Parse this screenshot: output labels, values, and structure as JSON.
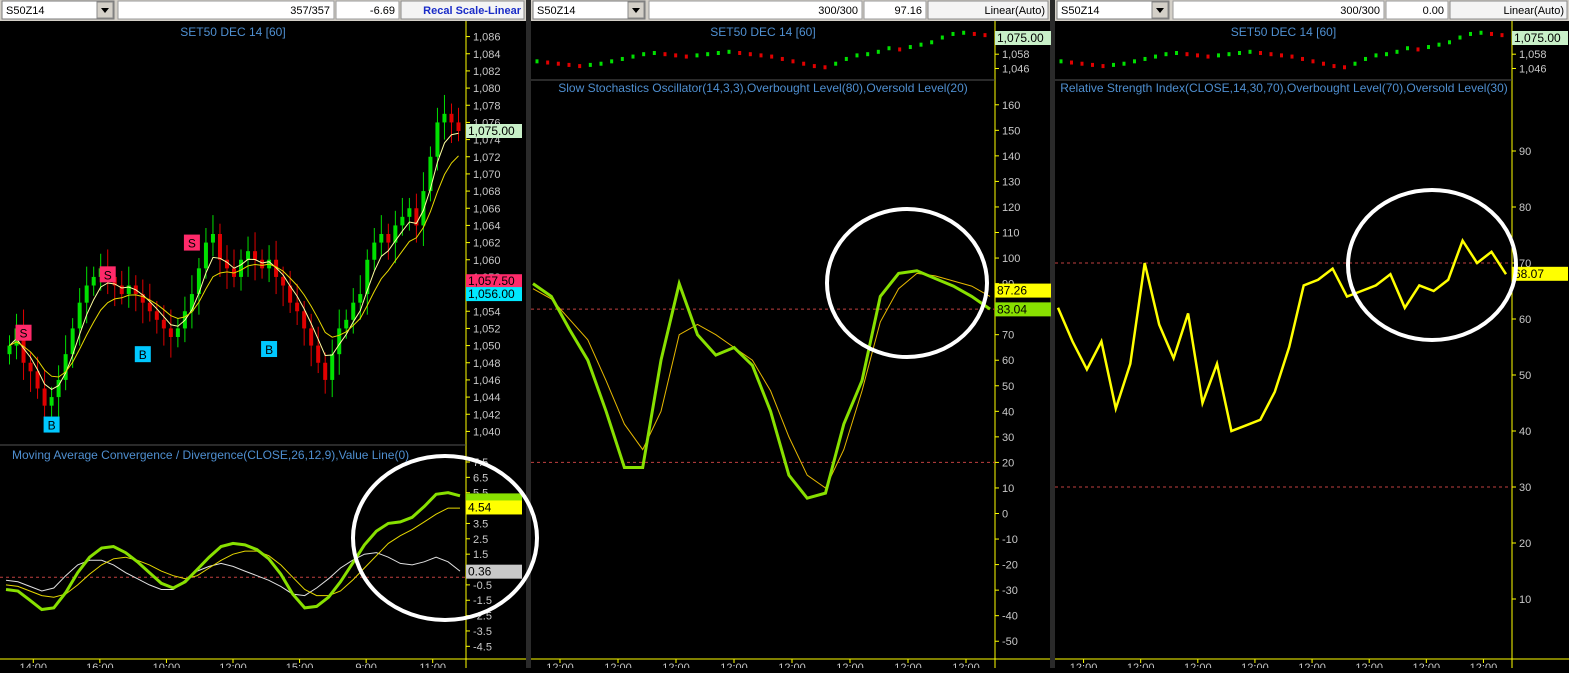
{
  "colors": {
    "background": "#000000",
    "axis": "#ffff00",
    "axis_label": "#c8c8c8",
    "title": "#4f8fd0",
    "up_candle": "#00e000",
    "down_candle": "#e00000",
    "macd_line": "#88e000",
    "signal_line": "#e6d800",
    "value_line": "#e0e0e0",
    "level_line": "#c04040",
    "rsi_line": "#ffff00",
    "buy_marker": "#00c8ff",
    "sell_marker": "#ff2a6a",
    "highlight_circle": "#ffffff"
  },
  "panels": [
    {
      "symbol": "S50Z14",
      "count": "357/357",
      "value": "-6.69",
      "scale_button": "Recal Scale-Linear",
      "price_title": "SET50 DEC 14  [60]"
    },
    {
      "symbol": "S50Z14",
      "count": "300/300",
      "value": "97.16",
      "scale_button": "Linear(Auto)",
      "price_title": "SET50 DEC 14  [60]",
      "indicator_title": "Slow Stochastics Oscillator(14,3,3),Overbought Level(80),Oversold Level(20)"
    },
    {
      "symbol": "S50Z14",
      "count": "300/300",
      "value": "0.00",
      "scale_button": "Linear(Auto)",
      "price_title": "SET50 DEC 14  [60]",
      "indicator_title": "Relative Strength Index(CLOSE,14,30,70),Overbought Level(70),Oversold Level(30)"
    }
  ],
  "chart_data": [
    {
      "type": "candlestick",
      "panel": "price-main",
      "title": "SET50 DEC 14  [60]",
      "ylim": [
        1039,
        1087
      ],
      "y_ticks": [
        "1,086",
        "1,084",
        "1,082",
        "1,080",
        "1,078",
        "1,076",
        "1,074",
        "1,072",
        "1,070",
        "1,068",
        "1,066",
        "1,064",
        "1,062",
        "1,060",
        "1,058",
        "1,056",
        "1,054",
        "1,052",
        "1,050",
        "1,048",
        "1,046",
        "1,044",
        "1,042",
        "1,040"
      ],
      "x_ticks": [
        "14:00",
        "16:00",
        "10:00",
        "12:00",
        "15:00",
        "9:00",
        "11:00"
      ],
      "closes": [
        1050,
        1052,
        1048,
        1047,
        1045,
        1043,
        1044,
        1046,
        1049,
        1052,
        1055,
        1057,
        1058,
        1059,
        1058,
        1057,
        1056,
        1057,
        1056,
        1055,
        1054,
        1053,
        1052,
        1051,
        1052,
        1054,
        1056,
        1059,
        1062,
        1063,
        1060,
        1059,
        1058,
        1060,
        1061,
        1060,
        1059,
        1060,
        1058,
        1057,
        1055,
        1054,
        1052,
        1050,
        1048,
        1046,
        1049,
        1052,
        1053,
        1055,
        1056,
        1060,
        1062,
        1063,
        1062,
        1064,
        1065,
        1066,
        1064,
        1068,
        1072,
        1076,
        1077,
        1076,
        1075
      ],
      "last_price": "1,075.00",
      "price_tags": [
        "1,057.50",
        "1,056.00"
      ],
      "signals": [
        {
          "label": "S",
          "index": 2,
          "price": 1051.5
        },
        {
          "label": "B",
          "index": 6,
          "price": 1040.8
        },
        {
          "label": "S",
          "index": 14,
          "price": 1058.3
        },
        {
          "label": "B",
          "index": 19,
          "price": 1049
        },
        {
          "label": "S",
          "index": 26,
          "price": 1062
        },
        {
          "label": "B",
          "index": 37,
          "price": 1049.6
        }
      ]
    },
    {
      "type": "line",
      "panel": "macd",
      "title": "Moving Average Convergence / Divergence(CLOSE,26,12,9),Value Line(0)",
      "ylim": [
        -5,
        7.5
      ],
      "y_ticks": [
        "7.5",
        "6.5",
        "5.5",
        "4.5",
        "3.5",
        "2.5",
        "1.5",
        "0.5",
        "-0.5",
        "-1.5",
        "-2.5",
        "-3.5",
        "-4.5"
      ],
      "x_ticks": [
        "14:00",
        "16:00",
        "10:00",
        "12:00",
        "15:00",
        "9:00",
        "11:00"
      ],
      "series": [
        {
          "values": [
            -0.8,
            -0.9,
            -1.5,
            -2.1,
            -2.0,
            -1.0,
            0.3,
            1.3,
            1.9,
            2.0,
            1.6,
            1.0,
            0.3,
            -0.4,
            -0.7,
            -0.3,
            0.5,
            1.3,
            2.0,
            2.2,
            2.1,
            1.8,
            1.2,
            0.2,
            -1.1,
            -2.0,
            -1.9,
            -1.3,
            -0.3,
            0.9,
            2.1,
            3.0,
            3.5,
            3.6,
            3.9,
            4.6,
            5.4,
            5.5,
            5.3
          ]
        },
        {
          "values": [
            -0.5,
            -0.6,
            -0.9,
            -1.2,
            -1.3,
            -1.1,
            -0.5,
            0.2,
            0.8,
            1.2,
            1.3,
            1.1,
            0.8,
            0.4,
            0.1,
            -0.1,
            0.1,
            0.6,
            1.1,
            1.5,
            1.7,
            1.7,
            1.4,
            0.8,
            0.0,
            -0.8,
            -1.2,
            -1.2,
            -0.9,
            -0.2,
            0.6,
            1.4,
            2.2,
            2.7,
            3.1,
            3.6,
            4.1,
            4.5,
            4.5
          ]
        },
        {
          "values": [
            -0.2,
            -0.3,
            -0.6,
            -0.9,
            -0.7,
            0.1,
            0.8,
            1.1,
            1.1,
            0.8,
            0.3,
            -0.1,
            -0.5,
            -0.8,
            -0.8,
            -0.2,
            0.4,
            0.7,
            0.9,
            0.7,
            0.4,
            0.1,
            -0.2,
            -0.6,
            -1.1,
            -1.2,
            -0.7,
            -0.1,
            0.6,
            1.1,
            1.5,
            1.6,
            1.3,
            0.9,
            0.8,
            1.0,
            1.3,
            1.0,
            0.4
          ]
        }
      ],
      "value_tags": [
        "4.54",
        "0.36"
      ]
    },
    {
      "type": "line",
      "panel": "stochastics",
      "title": "Slow Stochastics Oscillator(14,3,3),Overbought Level(80),Oversold Level(20)",
      "ylim": [
        -55,
        165
      ],
      "y_ticks": [
        "160",
        "150",
        "140",
        "130",
        "120",
        "110",
        "100",
        "90",
        "80",
        "70",
        "60",
        "50",
        "40",
        "30",
        "20",
        "10",
        "0",
        "-10",
        "-20",
        "-30",
        "-40",
        "-50"
      ],
      "levels": [
        80,
        20
      ],
      "x_ticks": [
        "12:00",
        "12:00",
        "12:00",
        "12:00",
        "12:00",
        "12:00",
        "12:00",
        "12:00"
      ],
      "series": [
        {
          "values": [
            90,
            85,
            72,
            60,
            40,
            18,
            18,
            60,
            90,
            70,
            62,
            65,
            58,
            40,
            15,
            6,
            8,
            35,
            52,
            85,
            94,
            95,
            92,
            89,
            85,
            80
          ]
        },
        {
          "values": [
            88,
            84,
            76,
            68,
            52,
            35,
            25,
            40,
            70,
            74,
            70,
            65,
            60,
            48,
            30,
            15,
            10,
            25,
            48,
            75,
            88,
            94,
            93,
            91,
            89,
            85
          ]
        }
      ],
      "value_tags": [
        "87.26",
        "83.04"
      ]
    },
    {
      "type": "line",
      "panel": "rsi",
      "title": "Relative Strength Index(CLOSE,14,30,70),Overbought Level(70),Oversold Level(30)",
      "ylim": [
        0,
        100
      ],
      "y_ticks": [
        "90",
        "80",
        "70",
        "60",
        "50",
        "40",
        "30",
        "20",
        "10"
      ],
      "levels": [
        70,
        30
      ],
      "x_ticks": [
        "12:00",
        "12:00",
        "12:00",
        "12:00",
        "12:00",
        "12:00",
        "12:00",
        "12:00"
      ],
      "series": [
        {
          "values": [
            62,
            56,
            51,
            56,
            44,
            52,
            70,
            59,
            53,
            61,
            45,
            52,
            40,
            41,
            42,
            47,
            55,
            66,
            67,
            69,
            64,
            65,
            66,
            68,
            62,
            66,
            65,
            67,
            74,
            70,
            72,
            68
          ]
        }
      ],
      "value_tags": [
        "68.07"
      ]
    },
    {
      "type": "line",
      "panel": "mini-price",
      "ylim": [
        1038,
        1080
      ],
      "y_ticks": [
        "1,058",
        "1,046"
      ],
      "last_price": "1,075.00",
      "values": [
        1052,
        1051,
        1050,
        1049,
        1048,
        1049,
        1050,
        1052,
        1054,
        1056,
        1058,
        1059,
        1058,
        1057,
        1056,
        1057,
        1058,
        1059,
        1060,
        1059,
        1058,
        1057,
        1056,
        1054,
        1052,
        1050,
        1048,
        1047,
        1050,
        1054,
        1057,
        1058,
        1060,
        1063,
        1062,
        1064,
        1066,
        1068,
        1072,
        1075,
        1076,
        1075,
        1074
      ]
    }
  ]
}
